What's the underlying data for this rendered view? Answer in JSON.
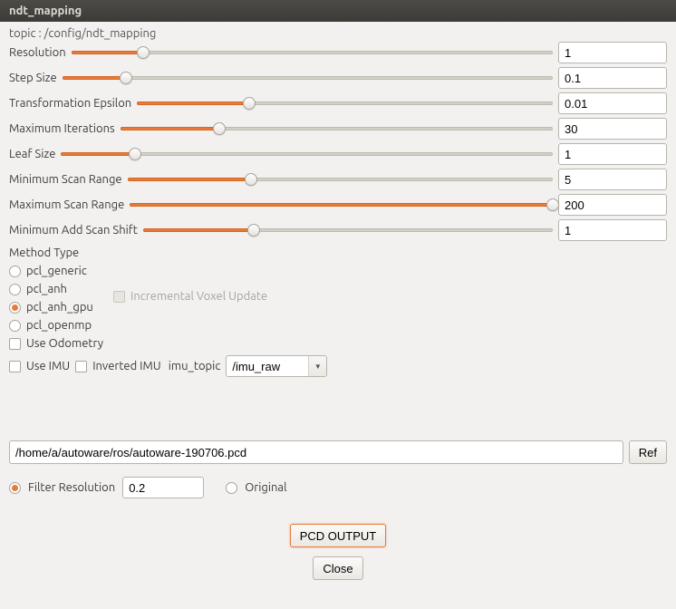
{
  "window": {
    "title": "ndt_mapping"
  },
  "topic_label": "topic : /config/ndt_mapping",
  "sliders": [
    {
      "label": "Resolution",
      "value": "1",
      "fill_pct": 15
    },
    {
      "label": "Step Size",
      "value": "0.1",
      "fill_pct": 13
    },
    {
      "label": "Transformation Epsilon",
      "value": "0.01",
      "fill_pct": 27
    },
    {
      "label": "Maximum Iterations",
      "value": "30",
      "fill_pct": 23
    },
    {
      "label": "Leaf Size",
      "value": "1",
      "fill_pct": 15
    },
    {
      "label": "Minimum Scan Range",
      "value": "5",
      "fill_pct": 29
    },
    {
      "label": "Maximum Scan Range",
      "value": "200",
      "fill_pct": 100
    },
    {
      "label": "Minimum Add Scan Shift",
      "value": "1",
      "fill_pct": 27
    }
  ],
  "method": {
    "section_label": "Method Type",
    "options": [
      {
        "label": "pcl_generic",
        "checked": false
      },
      {
        "label": "pcl_anh",
        "checked": false
      },
      {
        "label": "pcl_anh_gpu",
        "checked": true
      },
      {
        "label": "pcl_openmp",
        "checked": false
      }
    ],
    "incremental_label": "Incremental Voxel Update"
  },
  "checks": {
    "use_odometry": "Use Odometry",
    "use_imu": "Use IMU",
    "inverted_imu": "Inverted IMU"
  },
  "imu": {
    "label": "imu_topic",
    "value": "/imu_raw"
  },
  "path": {
    "value": "/home/a/autoware/ros/autoware-190706.pcd",
    "ref_button": "Ref"
  },
  "filter": {
    "filter_res_label": "Filter Resolution",
    "filter_res_value": "0.2",
    "original_label": "Original",
    "filter_checked": true
  },
  "buttons": {
    "pcd_output": "PCD OUTPUT",
    "close": "Close"
  }
}
